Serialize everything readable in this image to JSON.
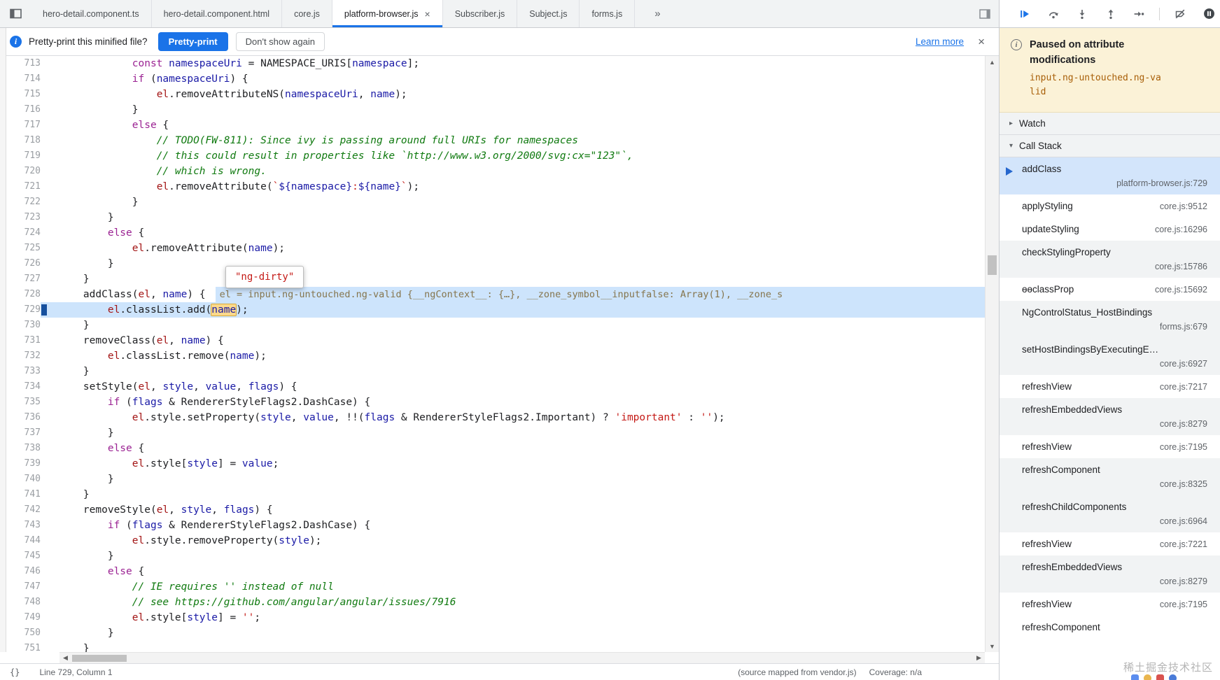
{
  "colors": {
    "accent": "#1a73e8",
    "execution_line": "#cde4fc",
    "paused_banner_bg": "#fbf2d7",
    "paused_subject_text": "#a85f08",
    "keyword": "#9b2393",
    "comment": "#107a10",
    "string": "#c41a16",
    "variable": "#1a1aa6",
    "token_highlight_bg": "#fbd98c"
  },
  "tab_bar": {
    "overflow_chevron": "»",
    "tabs": [
      {
        "label": "hero-detail.component.ts"
      },
      {
        "label": "hero-detail.component.html"
      },
      {
        "label": "core.js"
      },
      {
        "label": "platform-browser.js",
        "active": true,
        "close": "×"
      },
      {
        "label": "Subscriber.js"
      },
      {
        "label": "Subject.js"
      },
      {
        "label": "forms.js"
      }
    ]
  },
  "infobar": {
    "message": "Pretty-print this minified file?",
    "pretty_print_button": "Pretty-print",
    "dont_show_button": "Don't show again",
    "learn_more_link": "Learn more",
    "close": "×"
  },
  "editor": {
    "current_line": 729,
    "tooltip_value": "\"ng-dirty\"",
    "inline_eval": "el = input.ng-untouched.ng-valid {__ngContext__: {…}, __zone_symbol__inputfalse: Array(1), __zone_s",
    "lines": [
      {
        "no": 713,
        "ind": 12,
        "t": [
          [
            "kw",
            "const"
          ],
          [
            "pl",
            " "
          ],
          [
            "vn",
            "namespaceUri"
          ],
          [
            "pl",
            " = NAMESPACE_URIS["
          ],
          [
            "vn",
            "namespace"
          ],
          [
            "pl",
            "];"
          ]
        ]
      },
      {
        "no": 714,
        "ind": 12,
        "t": [
          [
            "kw",
            "if"
          ],
          [
            "pl",
            " ("
          ],
          [
            "vn",
            "namespaceUri"
          ],
          [
            "pl",
            ") {"
          ]
        ]
      },
      {
        "no": 715,
        "ind": 16,
        "t": [
          [
            "vr",
            "el"
          ],
          [
            "pl",
            ".removeAttributeNS("
          ],
          [
            "vn",
            "namespaceUri"
          ],
          [
            "pl",
            ", "
          ],
          [
            "vn",
            "name"
          ],
          [
            "pl",
            ");"
          ]
        ]
      },
      {
        "no": 716,
        "ind": 12,
        "t": [
          [
            "pl",
            "}"
          ]
        ]
      },
      {
        "no": 717,
        "ind": 12,
        "t": [
          [
            "kw",
            "else"
          ],
          [
            "pl",
            " {"
          ]
        ]
      },
      {
        "no": 718,
        "ind": 16,
        "t": [
          [
            "cm",
            "// TODO(FW-811): Since ivy is passing around full URIs for namespaces"
          ]
        ]
      },
      {
        "no": 719,
        "ind": 16,
        "t": [
          [
            "cm",
            "// this could result in properties like `http://www.w3.org/2000/svg:cx=\"123\"`,"
          ]
        ]
      },
      {
        "no": 720,
        "ind": 16,
        "t": [
          [
            "cm",
            "// which is wrong."
          ]
        ]
      },
      {
        "no": 721,
        "ind": 16,
        "t": [
          [
            "vr",
            "el"
          ],
          [
            "pl",
            ".removeAttribute("
          ],
          [
            "st",
            "`"
          ],
          [
            "vn",
            "${namespace}"
          ],
          [
            "st",
            ":"
          ],
          [
            "vn",
            "${name}"
          ],
          [
            "st",
            "`"
          ],
          [
            "pl",
            ");"
          ]
        ]
      },
      {
        "no": 722,
        "ind": 12,
        "t": [
          [
            "pl",
            "}"
          ]
        ]
      },
      {
        "no": 723,
        "ind": 8,
        "t": [
          [
            "pl",
            "}"
          ]
        ]
      },
      {
        "no": 724,
        "ind": 8,
        "t": [
          [
            "kw",
            "else"
          ],
          [
            "pl",
            " {"
          ]
        ]
      },
      {
        "no": 725,
        "ind": 12,
        "t": [
          [
            "vr",
            "el"
          ],
          [
            "pl",
            ".removeAttribute("
          ],
          [
            "vn",
            "name"
          ],
          [
            "pl",
            ");"
          ]
        ]
      },
      {
        "no": 726,
        "ind": 8,
        "t": [
          [
            "pl",
            "}"
          ]
        ]
      },
      {
        "no": 727,
        "ind": 4,
        "t": [
          [
            "pl",
            "}"
          ]
        ]
      },
      {
        "no": 728,
        "ind": 4,
        "eval": true,
        "t": [
          [
            "pl",
            "addClass("
          ],
          [
            "vr",
            "el"
          ],
          [
            "pl",
            ", "
          ],
          [
            "vn",
            "name"
          ],
          [
            "pl",
            ") {"
          ]
        ]
      },
      {
        "no": 729,
        "ind": 8,
        "t": [
          [
            "vr",
            "el"
          ],
          [
            "pl",
            ".classList.add("
          ],
          [
            "hl",
            "name"
          ],
          [
            "pl",
            ");"
          ]
        ]
      },
      {
        "no": 730,
        "ind": 4,
        "t": [
          [
            "pl",
            "}"
          ]
        ]
      },
      {
        "no": 731,
        "ind": 4,
        "t": [
          [
            "pl",
            "removeClass("
          ],
          [
            "vr",
            "el"
          ],
          [
            "pl",
            ", "
          ],
          [
            "vn",
            "name"
          ],
          [
            "pl",
            ") {"
          ]
        ]
      },
      {
        "no": 732,
        "ind": 8,
        "t": [
          [
            "vr",
            "el"
          ],
          [
            "pl",
            ".classList.remove("
          ],
          [
            "vn",
            "name"
          ],
          [
            "pl",
            ");"
          ]
        ]
      },
      {
        "no": 733,
        "ind": 4,
        "t": [
          [
            "pl",
            "}"
          ]
        ]
      },
      {
        "no": 734,
        "ind": 4,
        "t": [
          [
            "pl",
            "setStyle("
          ],
          [
            "vr",
            "el"
          ],
          [
            "pl",
            ", "
          ],
          [
            "vn",
            "style"
          ],
          [
            "pl",
            ", "
          ],
          [
            "vn",
            "value"
          ],
          [
            "pl",
            ", "
          ],
          [
            "vn",
            "flags"
          ],
          [
            "pl",
            ") {"
          ]
        ]
      },
      {
        "no": 735,
        "ind": 8,
        "t": [
          [
            "kw",
            "if"
          ],
          [
            "pl",
            " ("
          ],
          [
            "vn",
            "flags"
          ],
          [
            "pl",
            " & RendererStyleFlags2.DashCase) {"
          ]
        ]
      },
      {
        "no": 736,
        "ind": 12,
        "t": [
          [
            "vr",
            "el"
          ],
          [
            "pl",
            ".style.setProperty("
          ],
          [
            "vn",
            "style"
          ],
          [
            "pl",
            ", "
          ],
          [
            "vn",
            "value"
          ],
          [
            "pl",
            ", !!("
          ],
          [
            "vn",
            "flags"
          ],
          [
            "pl",
            " & RendererStyleFlags2.Important) ? "
          ],
          [
            "st",
            "'important'"
          ],
          [
            "pl",
            " : "
          ],
          [
            "st",
            "''"
          ],
          [
            "pl",
            ");"
          ]
        ]
      },
      {
        "no": 737,
        "ind": 8,
        "t": [
          [
            "pl",
            "}"
          ]
        ]
      },
      {
        "no": 738,
        "ind": 8,
        "t": [
          [
            "kw",
            "else"
          ],
          [
            "pl",
            " {"
          ]
        ]
      },
      {
        "no": 739,
        "ind": 12,
        "t": [
          [
            "vr",
            "el"
          ],
          [
            "pl",
            ".style["
          ],
          [
            "vn",
            "style"
          ],
          [
            "pl",
            "] = "
          ],
          [
            "vn",
            "value"
          ],
          [
            "pl",
            ";"
          ]
        ]
      },
      {
        "no": 740,
        "ind": 8,
        "t": [
          [
            "pl",
            "}"
          ]
        ]
      },
      {
        "no": 741,
        "ind": 4,
        "t": [
          [
            "pl",
            "}"
          ]
        ]
      },
      {
        "no": 742,
        "ind": 4,
        "t": [
          [
            "pl",
            "removeStyle("
          ],
          [
            "vr",
            "el"
          ],
          [
            "pl",
            ", "
          ],
          [
            "vn",
            "style"
          ],
          [
            "pl",
            ", "
          ],
          [
            "vn",
            "flags"
          ],
          [
            "pl",
            ") {"
          ]
        ]
      },
      {
        "no": 743,
        "ind": 8,
        "t": [
          [
            "kw",
            "if"
          ],
          [
            "pl",
            " ("
          ],
          [
            "vn",
            "flags"
          ],
          [
            "pl",
            " & RendererStyleFlags2.DashCase) {"
          ]
        ]
      },
      {
        "no": 744,
        "ind": 12,
        "t": [
          [
            "vr",
            "el"
          ],
          [
            "pl",
            ".style.removeProperty("
          ],
          [
            "vn",
            "style"
          ],
          [
            "pl",
            ");"
          ]
        ]
      },
      {
        "no": 745,
        "ind": 8,
        "t": [
          [
            "pl",
            "}"
          ]
        ]
      },
      {
        "no": 746,
        "ind": 8,
        "t": [
          [
            "kw",
            "else"
          ],
          [
            "pl",
            " {"
          ]
        ]
      },
      {
        "no": 747,
        "ind": 12,
        "t": [
          [
            "cm",
            "// IE requires '' instead of null"
          ]
        ]
      },
      {
        "no": 748,
        "ind": 12,
        "t": [
          [
            "cm",
            "// see https://github.com/angular/angular/issues/7916"
          ]
        ]
      },
      {
        "no": 749,
        "ind": 12,
        "t": [
          [
            "vr",
            "el"
          ],
          [
            "pl",
            ".style["
          ],
          [
            "vn",
            "style"
          ],
          [
            "pl",
            "] = "
          ],
          [
            "st",
            "''"
          ],
          [
            "pl",
            ";"
          ]
        ]
      },
      {
        "no": 750,
        "ind": 8,
        "t": [
          [
            "pl",
            "}"
          ]
        ]
      },
      {
        "no": 751,
        "ind": 4,
        "t": [
          [
            "pl",
            "}"
          ]
        ]
      }
    ]
  },
  "status_bar": {
    "pretty_print_icon": "{}",
    "position": "Line 729, Column 1",
    "source_map_note": "(source mapped from vendor.js)",
    "coverage": "Coverage: n/a"
  },
  "debug_sidebar": {
    "paused": {
      "title": "Paused on attribute modifications",
      "subject": "input.ng-untouched.ng-valid"
    },
    "watch": {
      "chevron": "▸",
      "label": "Watch"
    },
    "call_stack": {
      "chevron": "▾",
      "label": "Call Stack",
      "frames": [
        {
          "name": "addClass",
          "loc": "platform-browser.js:729",
          "current": true,
          "wrap": true
        },
        {
          "name": "applyStyling",
          "loc": "core.js:9512"
        },
        {
          "name": "updateStyling",
          "loc": "core.js:16296"
        },
        {
          "name": "checkStylingProperty",
          "loc": "core.js:15786",
          "wrap": true
        },
        {
          "name": "ɵɵclassProp",
          "loc": "core.js:15692"
        },
        {
          "name": "NgControlStatus_HostBindings",
          "loc": "forms.js:679",
          "wrap": true
        },
        {
          "name": "setHostBindingsByExecutingE…",
          "loc": "core.js:6927",
          "wrap": true
        },
        {
          "name": "refreshView",
          "loc": "core.js:7217"
        },
        {
          "name": "refreshEmbeddedViews",
          "loc": "core.js:8279",
          "wrap": true
        },
        {
          "name": "refreshView",
          "loc": "core.js:7195"
        },
        {
          "name": "refreshComponent",
          "loc": "core.js:8325",
          "wrap": true
        },
        {
          "name": "refreshChildComponents",
          "loc": "core.js:6964",
          "wrap": true
        },
        {
          "name": "refreshView",
          "loc": "core.js:7221"
        },
        {
          "name": "refreshEmbeddedViews",
          "loc": "core.js:8279",
          "wrap": true
        },
        {
          "name": "refreshView",
          "loc": "core.js:7195"
        },
        {
          "name": "refreshComponent",
          "loc": ""
        }
      ]
    }
  },
  "watermark": {
    "text": "稀土掘金技术社区"
  }
}
